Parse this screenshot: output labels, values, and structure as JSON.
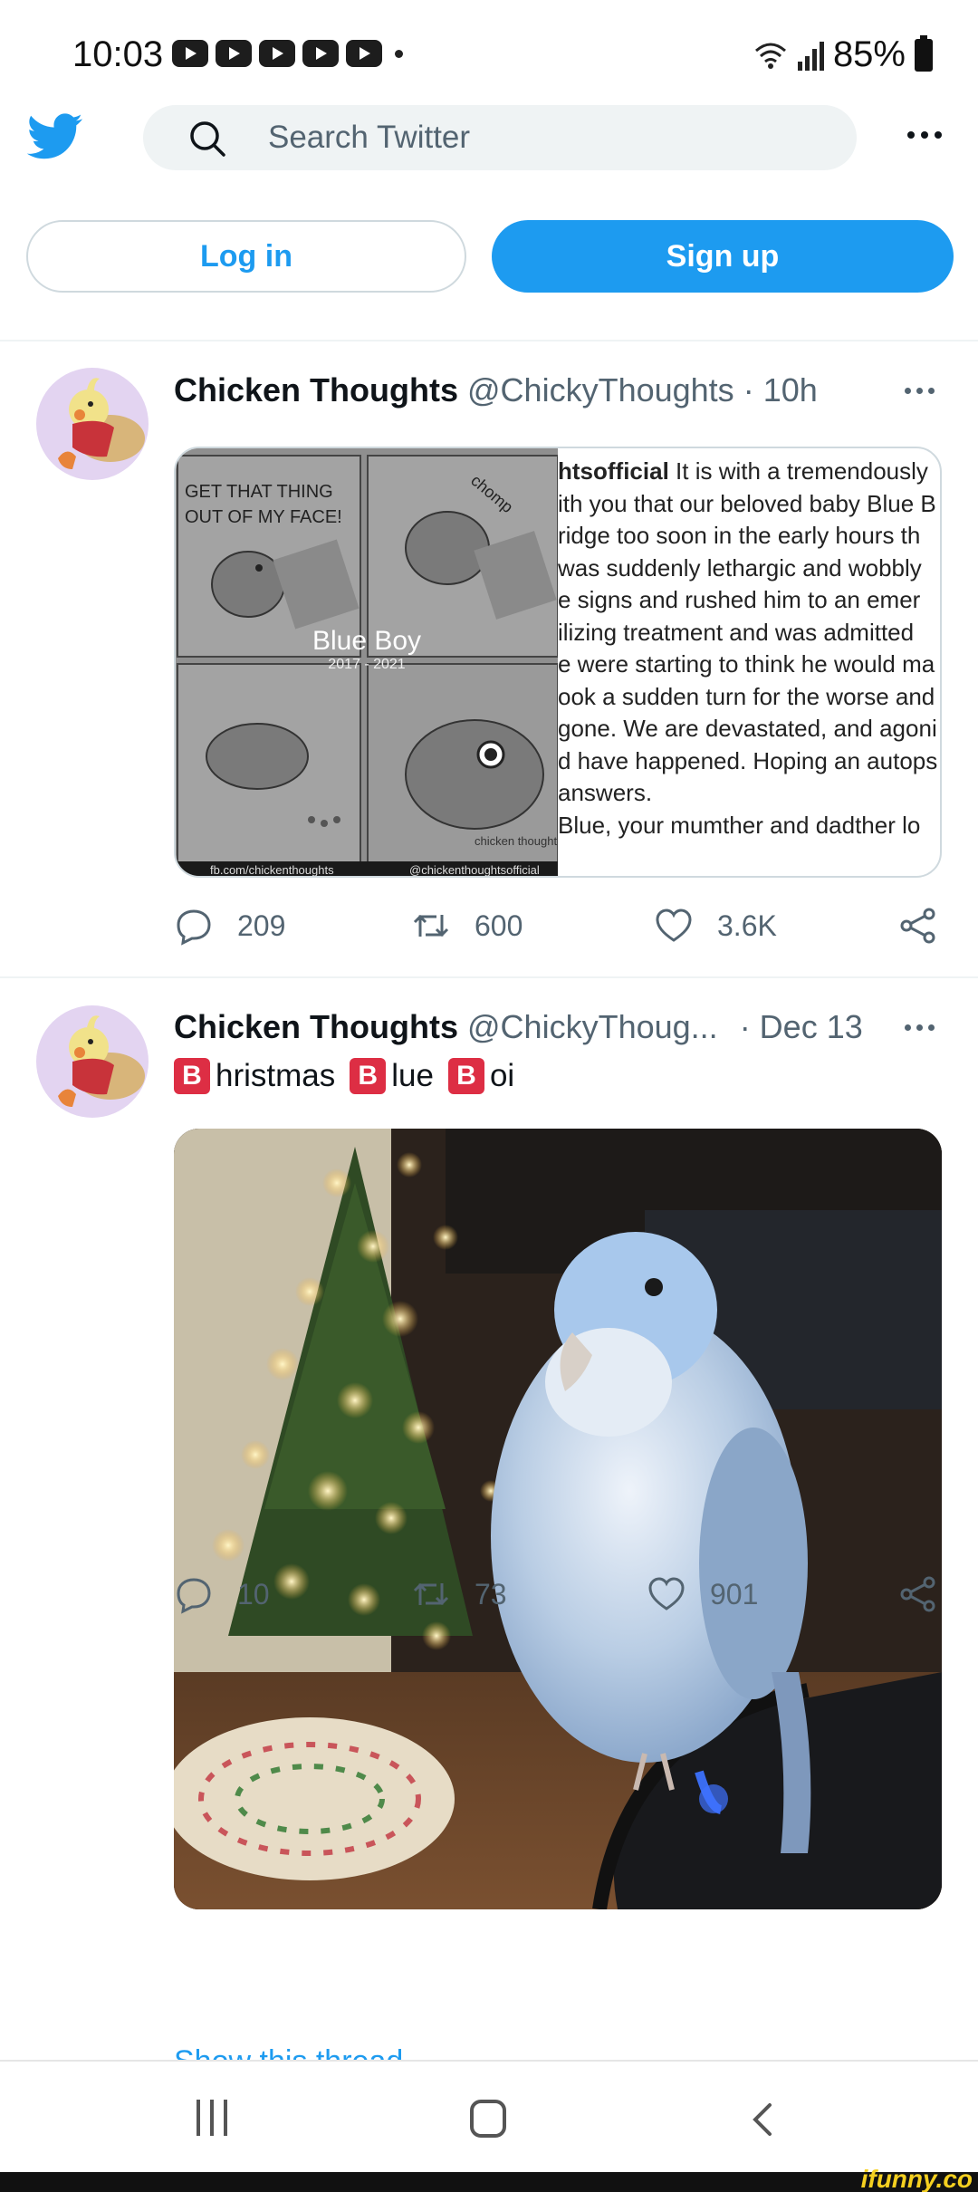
{
  "status_bar": {
    "time": "10:03",
    "battery": "85%"
  },
  "header": {
    "search_placeholder": "Search Twitter"
  },
  "auth": {
    "login_label": "Log in",
    "signup_label": "Sign up"
  },
  "tweets": [
    {
      "author_name": "Chicken Thoughts",
      "author_handle": "@ChickyThoughts",
      "time": "· 10h",
      "comic": {
        "panel_text": "GET THAT THING OUT OF MY FACE!",
        "sound_effect": "chomp",
        "title": "Blue Boy",
        "years": "2017 - 2021",
        "signature": "chicken thought",
        "footer_left": "fb.com/chickenthoughts",
        "footer_right": "@chickenthoughtsofficial"
      },
      "caption_lines": [
        "It is with a tremendously",
        "ith you that our beloved baby Blue B",
        "ridge too soon in the early hours th",
        "was suddenly lethargic and wobbly",
        "e signs and rushed him to an emer",
        "ilizing treatment and was admitted",
        "e were starting to think he would ma",
        "ook a sudden turn for the worse and",
        "gone. We are devastated, and agoni",
        "d have happened. Hoping an autops",
        "answers.",
        "Blue, your mumther and dadther lo"
      ],
      "caption_bold": "htsofficial",
      "replies": "209",
      "retweets": "600",
      "likes": "3.6K"
    },
    {
      "author_name": "Chicken Thoughts",
      "author_handle": "@ChickyThoug...",
      "time": "· Dec 13",
      "text_parts": [
        "B",
        "hristmas",
        "B",
        "lue",
        "B",
        "oi"
      ],
      "replies": "10",
      "retweets": "73",
      "likes": "901"
    }
  ],
  "show_thread": "Show this thread",
  "watermark": "ifunny.co",
  "colors": {
    "accent": "#1d9bf0",
    "text": "#0f1419",
    "secondary": "#536471",
    "emoji_red": "#dd2e44"
  }
}
